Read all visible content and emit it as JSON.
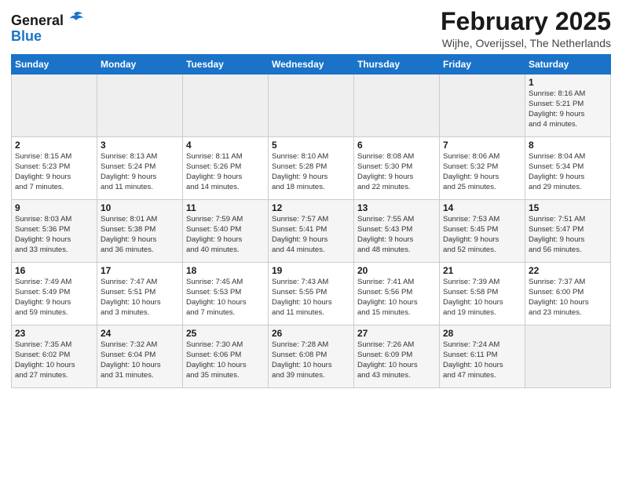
{
  "header": {
    "logo_line1": "General",
    "logo_line2": "Blue",
    "month_year": "February 2025",
    "location": "Wijhe, Overijssel, The Netherlands"
  },
  "weekdays": [
    "Sunday",
    "Monday",
    "Tuesday",
    "Wednesday",
    "Thursday",
    "Friday",
    "Saturday"
  ],
  "weeks": [
    [
      {
        "day": "",
        "info": ""
      },
      {
        "day": "",
        "info": ""
      },
      {
        "day": "",
        "info": ""
      },
      {
        "day": "",
        "info": ""
      },
      {
        "day": "",
        "info": ""
      },
      {
        "day": "",
        "info": ""
      },
      {
        "day": "1",
        "info": "Sunrise: 8:16 AM\nSunset: 5:21 PM\nDaylight: 9 hours\nand 4 minutes."
      }
    ],
    [
      {
        "day": "2",
        "info": "Sunrise: 8:15 AM\nSunset: 5:23 PM\nDaylight: 9 hours\nand 7 minutes."
      },
      {
        "day": "3",
        "info": "Sunrise: 8:13 AM\nSunset: 5:24 PM\nDaylight: 9 hours\nand 11 minutes."
      },
      {
        "day": "4",
        "info": "Sunrise: 8:11 AM\nSunset: 5:26 PM\nDaylight: 9 hours\nand 14 minutes."
      },
      {
        "day": "5",
        "info": "Sunrise: 8:10 AM\nSunset: 5:28 PM\nDaylight: 9 hours\nand 18 minutes."
      },
      {
        "day": "6",
        "info": "Sunrise: 8:08 AM\nSunset: 5:30 PM\nDaylight: 9 hours\nand 22 minutes."
      },
      {
        "day": "7",
        "info": "Sunrise: 8:06 AM\nSunset: 5:32 PM\nDaylight: 9 hours\nand 25 minutes."
      },
      {
        "day": "8",
        "info": "Sunrise: 8:04 AM\nSunset: 5:34 PM\nDaylight: 9 hours\nand 29 minutes."
      }
    ],
    [
      {
        "day": "9",
        "info": "Sunrise: 8:03 AM\nSunset: 5:36 PM\nDaylight: 9 hours\nand 33 minutes."
      },
      {
        "day": "10",
        "info": "Sunrise: 8:01 AM\nSunset: 5:38 PM\nDaylight: 9 hours\nand 36 minutes."
      },
      {
        "day": "11",
        "info": "Sunrise: 7:59 AM\nSunset: 5:40 PM\nDaylight: 9 hours\nand 40 minutes."
      },
      {
        "day": "12",
        "info": "Sunrise: 7:57 AM\nSunset: 5:41 PM\nDaylight: 9 hours\nand 44 minutes."
      },
      {
        "day": "13",
        "info": "Sunrise: 7:55 AM\nSunset: 5:43 PM\nDaylight: 9 hours\nand 48 minutes."
      },
      {
        "day": "14",
        "info": "Sunrise: 7:53 AM\nSunset: 5:45 PM\nDaylight: 9 hours\nand 52 minutes."
      },
      {
        "day": "15",
        "info": "Sunrise: 7:51 AM\nSunset: 5:47 PM\nDaylight: 9 hours\nand 56 minutes."
      }
    ],
    [
      {
        "day": "16",
        "info": "Sunrise: 7:49 AM\nSunset: 5:49 PM\nDaylight: 9 hours\nand 59 minutes."
      },
      {
        "day": "17",
        "info": "Sunrise: 7:47 AM\nSunset: 5:51 PM\nDaylight: 10 hours\nand 3 minutes."
      },
      {
        "day": "18",
        "info": "Sunrise: 7:45 AM\nSunset: 5:53 PM\nDaylight: 10 hours\nand 7 minutes."
      },
      {
        "day": "19",
        "info": "Sunrise: 7:43 AM\nSunset: 5:55 PM\nDaylight: 10 hours\nand 11 minutes."
      },
      {
        "day": "20",
        "info": "Sunrise: 7:41 AM\nSunset: 5:56 PM\nDaylight: 10 hours\nand 15 minutes."
      },
      {
        "day": "21",
        "info": "Sunrise: 7:39 AM\nSunset: 5:58 PM\nDaylight: 10 hours\nand 19 minutes."
      },
      {
        "day": "22",
        "info": "Sunrise: 7:37 AM\nSunset: 6:00 PM\nDaylight: 10 hours\nand 23 minutes."
      }
    ],
    [
      {
        "day": "23",
        "info": "Sunrise: 7:35 AM\nSunset: 6:02 PM\nDaylight: 10 hours\nand 27 minutes."
      },
      {
        "day": "24",
        "info": "Sunrise: 7:32 AM\nSunset: 6:04 PM\nDaylight: 10 hours\nand 31 minutes."
      },
      {
        "day": "25",
        "info": "Sunrise: 7:30 AM\nSunset: 6:06 PM\nDaylight: 10 hours\nand 35 minutes."
      },
      {
        "day": "26",
        "info": "Sunrise: 7:28 AM\nSunset: 6:08 PM\nDaylight: 10 hours\nand 39 minutes."
      },
      {
        "day": "27",
        "info": "Sunrise: 7:26 AM\nSunset: 6:09 PM\nDaylight: 10 hours\nand 43 minutes."
      },
      {
        "day": "28",
        "info": "Sunrise: 7:24 AM\nSunset: 6:11 PM\nDaylight: 10 hours\nand 47 minutes."
      },
      {
        "day": "",
        "info": ""
      }
    ]
  ]
}
